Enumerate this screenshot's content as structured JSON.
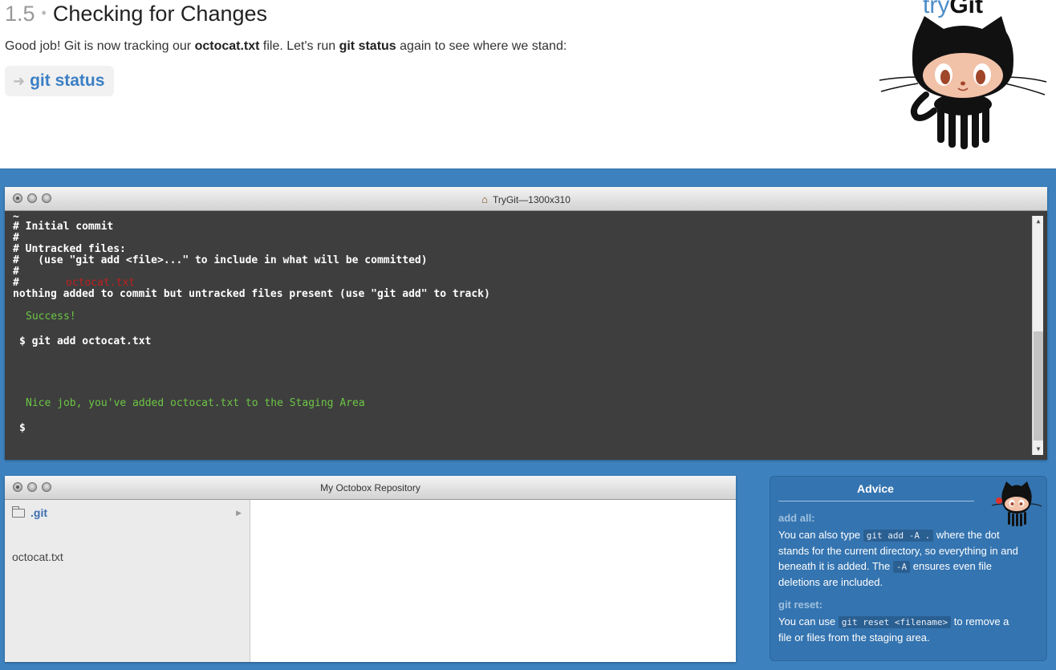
{
  "lesson": {
    "number": "1.5",
    "title": "Checking for Changes",
    "desc_1": "Good job! Git is now tracking our ",
    "desc_file": "octocat.txt",
    "desc_2": " file. Let's run ",
    "desc_cmd": "git status",
    "desc_3": " again to see where we stand:",
    "command": "git status"
  },
  "brand": {
    "try": "try",
    "git": "Git"
  },
  "terminal": {
    "title": "TryGit—1300x310",
    "lines": [
      "~",
      "# Initial commit",
      "#",
      "# Untracked files:",
      "#   (use \"git add <file>...\" to include in what will be committed)",
      "#",
      "#",
      "nothing added to commit but untracked files present (use \"git add\" to track)"
    ],
    "untracked_file": "octocat.txt",
    "success": "Success!",
    "prompt_cmd": "$ git add octocat.txt",
    "nice_job": "Nice job, you've added octocat.txt to the Staging Area",
    "prompt": "$"
  },
  "repo": {
    "title": "My Octobox Repository",
    "folder": ".git",
    "file": "octocat.txt"
  },
  "advice": {
    "title": "Advice",
    "h1": "add all:",
    "p1_a": "You can also type ",
    "p1_code": "git add -A .",
    "p1_b": " where the dot stands for the current directory, so everything in and beneath it is added. The ",
    "p1_code2": "-A",
    "p1_c": " ensures even file deletions are included.",
    "h2": "git reset:",
    "p2_a": "You can use ",
    "p2_code": "git reset <filename>",
    "p2_b": " to remove a file or files from the staging area."
  },
  "colors": {
    "blue_bg": "#3d82bf",
    "link": "#3b7fc4",
    "terminal_bg": "#3e3e3e",
    "green": "#6cc644",
    "red": "#c02020"
  },
  "icons": [
    "arrow-icon",
    "home-icon",
    "folder-icon",
    "chevron-right-icon",
    "octocat-logo"
  ]
}
